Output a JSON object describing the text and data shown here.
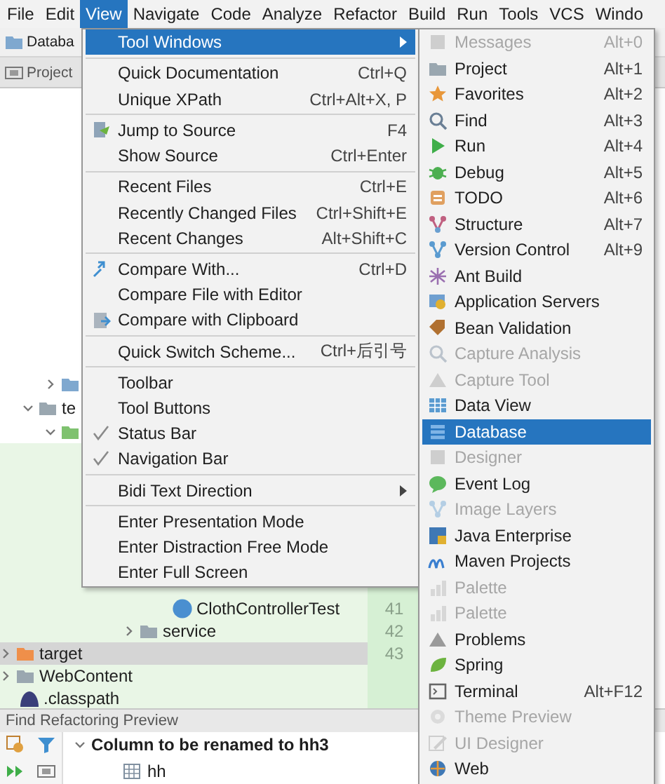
{
  "menu_bar": [
    {
      "label": "File",
      "selected": false
    },
    {
      "label": "Edit",
      "selected": false
    },
    {
      "label": "View",
      "selected": true
    },
    {
      "label": "Navigate",
      "selected": false
    },
    {
      "label": "Code",
      "selected": false
    },
    {
      "label": "Analyze",
      "selected": false
    },
    {
      "label": "Refactor",
      "selected": false
    },
    {
      "label": "Build",
      "selected": false
    },
    {
      "label": "Run",
      "selected": false
    },
    {
      "label": "Tools",
      "selected": false
    },
    {
      "label": "VCS",
      "selected": false
    },
    {
      "label": "Windo",
      "selected": false
    }
  ],
  "toolbar": {
    "breadcrumb": "Databa"
  },
  "project_tab": {
    "label": "Project"
  },
  "project_tree": {
    "upper_rows": [
      {
        "expanded": false
      },
      {
        "text": "te",
        "expanded": true
      },
      {
        "expanded": true
      }
    ],
    "lower_rows": [
      {
        "text": "ClothControllerTest",
        "selected": false
      },
      {
        "text": "service",
        "expanded": false,
        "selected": false
      },
      {
        "text": "target",
        "expanded": false,
        "selected": true
      },
      {
        "text": "WebContent",
        "expanded": false,
        "selected": false
      },
      {
        "text": ".classpath",
        "selected": false
      }
    ]
  },
  "line_numbers": [
    "41",
    "42",
    "43"
  ],
  "view_menu": {
    "items": [
      {
        "kind": "item",
        "label": "Tool Windows",
        "selected": true,
        "checked": false,
        "submenu": true
      },
      {
        "kind": "separator"
      },
      {
        "kind": "item",
        "label": "Quick Documentation",
        "shortcut": "Ctrl+Q",
        "selected": false,
        "checked": false,
        "submenu": false
      },
      {
        "kind": "item",
        "label": "Unique XPath",
        "shortcut": "Ctrl+Alt+X, P",
        "selected": false,
        "checked": false,
        "submenu": false
      },
      {
        "kind": "separator"
      },
      {
        "kind": "item",
        "label": "Jump to Source",
        "shortcut": "F4",
        "selected": false,
        "checked": false,
        "submenu": false
      },
      {
        "kind": "item",
        "label": "Show Source",
        "shortcut": "Ctrl+Enter",
        "selected": false,
        "checked": false,
        "submenu": false
      },
      {
        "kind": "separator"
      },
      {
        "kind": "item",
        "label": "Recent Files",
        "shortcut": "Ctrl+E",
        "selected": false,
        "checked": false,
        "submenu": false
      },
      {
        "kind": "item",
        "label": "Recently Changed Files",
        "shortcut": "Ctrl+Shift+E",
        "selected": false,
        "checked": false,
        "submenu": false
      },
      {
        "kind": "item",
        "label": "Recent Changes",
        "shortcut": "Alt+Shift+C",
        "selected": false,
        "checked": false,
        "submenu": false
      },
      {
        "kind": "separator"
      },
      {
        "kind": "item",
        "label": "Compare With...",
        "shortcut": "Ctrl+D",
        "selected": false,
        "checked": false,
        "submenu": false
      },
      {
        "kind": "item",
        "label": "Compare File with Editor",
        "selected": false,
        "checked": false,
        "submenu": false
      },
      {
        "kind": "item",
        "label": "Compare with Clipboard",
        "selected": false,
        "checked": false,
        "submenu": false
      },
      {
        "kind": "separator"
      },
      {
        "kind": "item",
        "label": "Quick Switch Scheme...",
        "shortcut": "Ctrl+后引号",
        "selected": false,
        "checked": false,
        "submenu": false
      },
      {
        "kind": "separator"
      },
      {
        "kind": "item",
        "label": "Toolbar",
        "selected": false,
        "checked": false,
        "submenu": false
      },
      {
        "kind": "item",
        "label": "Tool Buttons",
        "selected": false,
        "checked": false,
        "submenu": false
      },
      {
        "kind": "item",
        "label": "Status Bar",
        "selected": false,
        "checked": true,
        "submenu": false
      },
      {
        "kind": "item",
        "label": "Navigation Bar",
        "selected": false,
        "checked": true,
        "submenu": false
      },
      {
        "kind": "separator"
      },
      {
        "kind": "item",
        "label": "Bidi Text Direction",
        "selected": false,
        "checked": false,
        "submenu": true
      },
      {
        "kind": "separator"
      },
      {
        "kind": "item",
        "label": "Enter Presentation Mode",
        "selected": false,
        "checked": false,
        "submenu": false
      },
      {
        "kind": "item",
        "label": "Enter Distraction Free Mode",
        "selected": false,
        "checked": false,
        "submenu": false
      },
      {
        "kind": "item",
        "label": "Enter Full Screen",
        "selected": false,
        "checked": false,
        "submenu": false
      }
    ]
  },
  "tool_windows_menu": {
    "items": [
      {
        "label": "Messages",
        "shortcut": "Alt+0",
        "disabled": true,
        "selected": false
      },
      {
        "label": "Project",
        "shortcut": "Alt+1",
        "disabled": false,
        "selected": false
      },
      {
        "label": "Favorites",
        "shortcut": "Alt+2",
        "disabled": false,
        "selected": false
      },
      {
        "label": "Find",
        "shortcut": "Alt+3",
        "disabled": false,
        "selected": false
      },
      {
        "label": "Run",
        "shortcut": "Alt+4",
        "disabled": false,
        "selected": false
      },
      {
        "label": "Debug",
        "shortcut": "Alt+5",
        "disabled": false,
        "selected": false
      },
      {
        "label": "TODO",
        "shortcut": "Alt+6",
        "disabled": false,
        "selected": false
      },
      {
        "label": "Structure",
        "shortcut": "Alt+7",
        "disabled": false,
        "selected": false
      },
      {
        "label": "Version Control",
        "shortcut": "Alt+9",
        "disabled": false,
        "selected": false
      },
      {
        "label": "Ant Build",
        "disabled": false,
        "selected": false
      },
      {
        "label": "Application Servers",
        "disabled": false,
        "selected": false
      },
      {
        "label": "Bean Validation",
        "disabled": false,
        "selected": false
      },
      {
        "label": "Capture Analysis",
        "disabled": true,
        "selected": false
      },
      {
        "label": "Capture Tool",
        "disabled": true,
        "selected": false
      },
      {
        "label": "Data View",
        "disabled": false,
        "selected": false
      },
      {
        "label": "Database",
        "disabled": false,
        "selected": true
      },
      {
        "label": "Designer",
        "disabled": true,
        "selected": false
      },
      {
        "label": "Event Log",
        "disabled": false,
        "selected": false
      },
      {
        "label": "Image Layers",
        "disabled": true,
        "selected": false
      },
      {
        "label": "Java Enterprise",
        "disabled": false,
        "selected": false
      },
      {
        "label": "Maven Projects",
        "disabled": false,
        "selected": false
      },
      {
        "label": "Palette",
        "disabled": true,
        "selected": false
      },
      {
        "label": "Palette",
        "disabled": true,
        "selected": false
      },
      {
        "label": "Problems",
        "disabled": false,
        "selected": false
      },
      {
        "label": "Spring",
        "disabled": false,
        "selected": false
      },
      {
        "label": "Terminal",
        "shortcut": "Alt+F12",
        "disabled": false,
        "selected": false
      },
      {
        "label": "Theme Preview",
        "disabled": true,
        "selected": false
      },
      {
        "label": "UI Designer",
        "disabled": true,
        "selected": false
      },
      {
        "label": "Web",
        "disabled": false,
        "selected": false
      }
    ]
  },
  "bottom_panel": {
    "title": "Find Refactoring Preview",
    "rows": [
      {
        "text": "Column to be renamed to hh3",
        "kind": "group",
        "expanded": true
      },
      {
        "text": "hh",
        "kind": "table"
      }
    ]
  }
}
